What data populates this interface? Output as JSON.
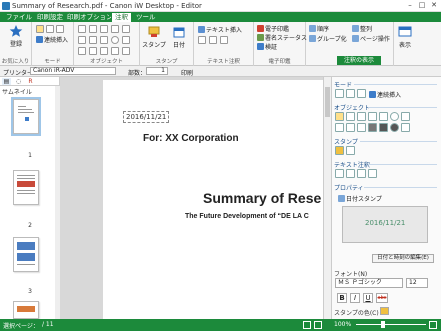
{
  "window": {
    "title": "Summary of Research.pdf - Canon iW Desktop - Editor",
    "min": "–",
    "max": "□",
    "close": "✕"
  },
  "menu": [
    {
      "label": "ファイル"
    },
    {
      "label": "印刷設定"
    },
    {
      "label": "印刷オプション"
    },
    {
      "label": "注釈"
    },
    {
      "label": "ツール"
    }
  ],
  "ribbon": {
    "favorites": {
      "register": "登録",
      "group_label": "お気に入り"
    },
    "mode": {
      "select_text": "選択",
      "link_insert": "連続挿入",
      "group_label": "モード"
    },
    "object": {
      "group_label": "オブジェクト"
    },
    "stamp": {
      "stamp": "スタンプ",
      "date": "日付",
      "group_label": "スタンプ"
    },
    "text_note": {
      "text_insert": "テキスト挿入",
      "group_label": "テキスト注釈"
    },
    "esign": {
      "item1": "電子印鑑",
      "item2": "署名ステータス",
      "item3": "検証",
      "group_label": "電子印鑑"
    },
    "order": {
      "order": "順序",
      "group": "グループ化",
      "align": "整列",
      "page_op": "ページ操作",
      "group_label": "操作"
    },
    "display": {
      "label": "表示"
    },
    "annotation_display": "注釈の表示"
  },
  "toolbar2": {
    "printer_label": "プリンター：",
    "printer_value": "Canon iR-ADV",
    "copies_label": "部数：",
    "copies_value": "1",
    "print_label": "印刷"
  },
  "left_panel": {
    "header": "サムネイル",
    "page_numbers": [
      "1",
      "2",
      "3",
      "4"
    ]
  },
  "document": {
    "date_stamp": "2016/11/21",
    "for_line": "For: XX Corporation",
    "title": "Summary of Rese",
    "subtitle": "The Future Development of “DE LA C"
  },
  "right_panel": {
    "mode_label": "モード",
    "mode_insert": "連続挿入",
    "object_label": "オブジェクト",
    "stamp_label": "スタンプ",
    "text_note_label": "テキスト注釈",
    "properties_label": "プロパティー",
    "date_stamp_label": "日付スタンプ",
    "preview_date": "2016/11/21",
    "edit_date_btn": "日付と時刻の編集(E)",
    "font_label": "フォント(N)",
    "font_value": "ＭＳ Ｐゴシック",
    "font_size": "12",
    "bold": "B",
    "italic": "I",
    "underline": "U",
    "strike": "abc",
    "stamp_color_label": "スタンプの色(C)"
  },
  "status": {
    "selected_page": "選択ページ：",
    "page_count": "/ 11",
    "zoom": "100%"
  },
  "colors": {
    "menubar": "#1c8a3b",
    "accent_blue": "#2a7ab8",
    "stamp_green": "#4a8f6b"
  }
}
